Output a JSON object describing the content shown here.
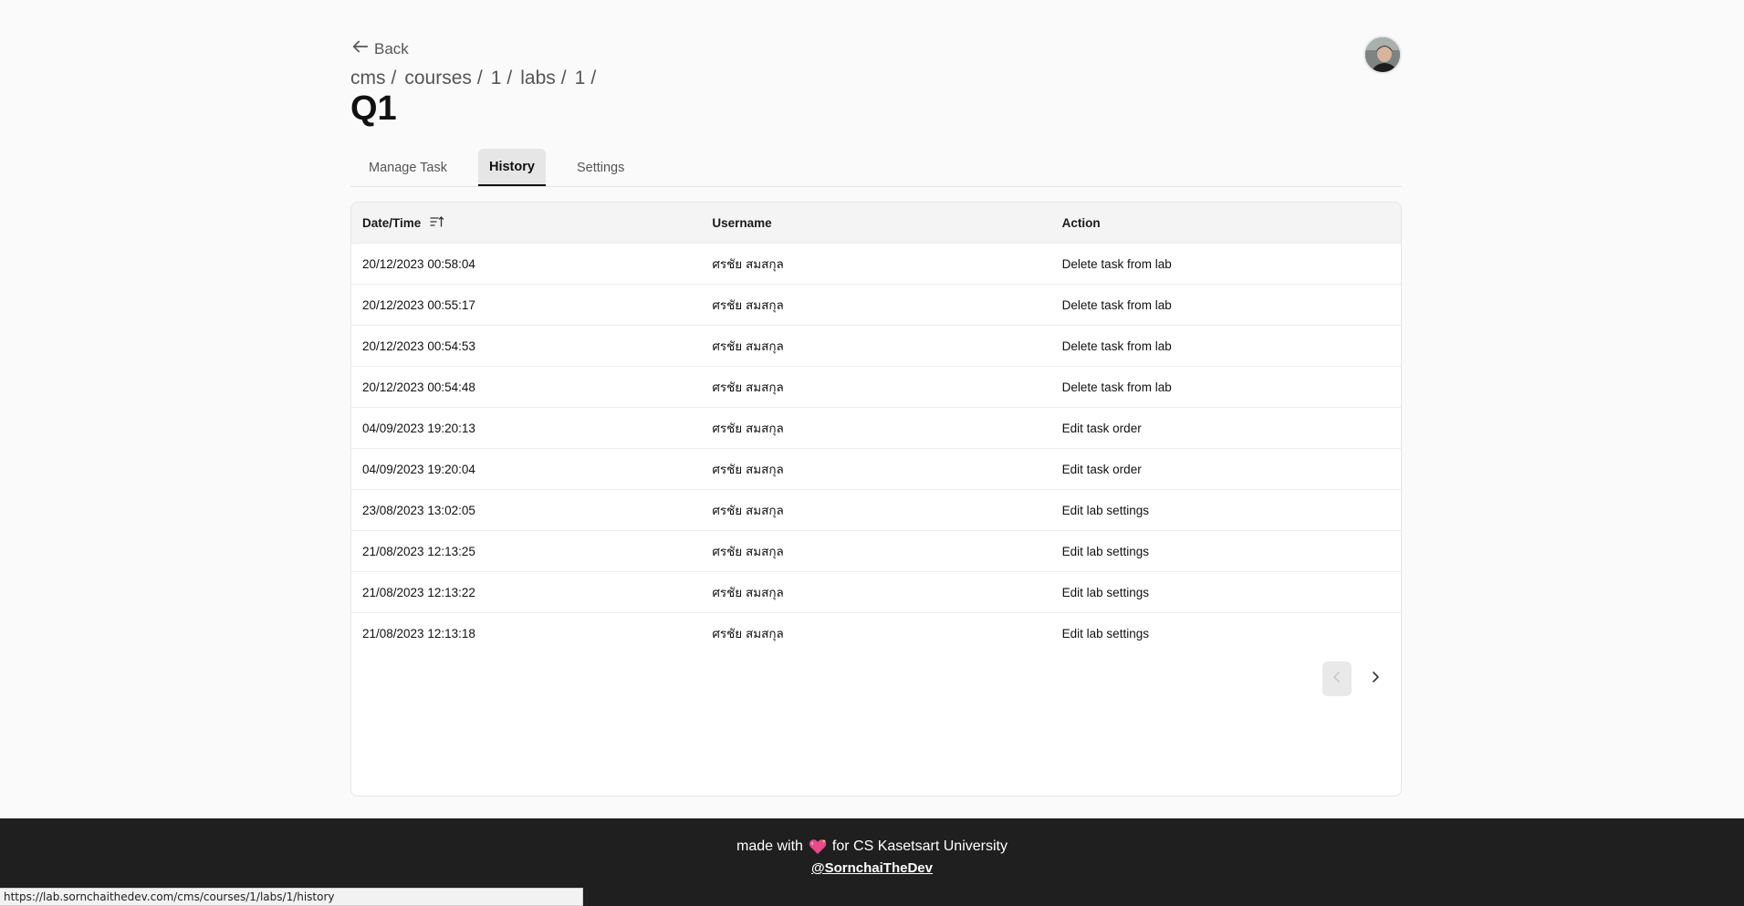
{
  "nav": {
    "back_label": "Back"
  },
  "breadcrumb": [
    {
      "label": "cms",
      "sep": "/"
    },
    {
      "label": "courses",
      "sep": "/"
    },
    {
      "label": "1",
      "sep": "/"
    },
    {
      "label": "labs",
      "sep": "/"
    },
    {
      "label": "1",
      "sep": "/"
    }
  ],
  "page": {
    "title": "Q1"
  },
  "tabs": [
    {
      "label": "Manage Task",
      "active": false
    },
    {
      "label": "History",
      "active": true
    },
    {
      "label": "Settings",
      "active": false
    }
  ],
  "table": {
    "headers": {
      "datetime": "Date/Time",
      "username": "Username",
      "action": "Action"
    },
    "rows": [
      {
        "datetime": "20/12/2023 00:58:04",
        "username": "ศรชัย สมสกุล",
        "action": "Delete task from lab"
      },
      {
        "datetime": "20/12/2023 00:55:17",
        "username": "ศรชัย สมสกุล",
        "action": "Delete task from lab"
      },
      {
        "datetime": "20/12/2023 00:54:53",
        "username": "ศรชัย สมสกุล",
        "action": "Delete task from lab"
      },
      {
        "datetime": "20/12/2023 00:54:48",
        "username": "ศรชัย สมสกุล",
        "action": "Delete task from lab"
      },
      {
        "datetime": "04/09/2023 19:20:13",
        "username": "ศรชัย สมสกุล",
        "action": "Edit task order"
      },
      {
        "datetime": "04/09/2023 19:20:04",
        "username": "ศรชัย สมสกุล",
        "action": "Edit task order"
      },
      {
        "datetime": "23/08/2023 13:02:05",
        "username": "ศรชัย สมสกุล",
        "action": "Edit lab settings"
      },
      {
        "datetime": "21/08/2023 12:13:25",
        "username": "ศรชัย สมสกุล",
        "action": "Edit lab settings"
      },
      {
        "datetime": "21/08/2023 12:13:22",
        "username": "ศรชัย สมสกุล",
        "action": "Edit lab settings"
      },
      {
        "datetime": "21/08/2023 12:13:18",
        "username": "ศรชัย สมสกุล",
        "action": "Edit lab settings"
      }
    ]
  },
  "pagination": {
    "prev_disabled": true
  },
  "footer": {
    "made_with": "made with",
    "for_text": "for CS Kasetsart University",
    "handle": "@SornchaiTheDev"
  },
  "status_bar": {
    "url": "https://lab.sornchaithedev.com/cms/courses/1/labs/1/history"
  },
  "icons": {
    "back": "arrow-left-icon",
    "sort": "sort-ascending-icon",
    "prev": "chevron-left-icon",
    "next": "chevron-right-icon",
    "heart": "sparkling-heart-icon"
  },
  "colors": {
    "footer_bg": "#1f1f1f",
    "heart": "#e84a8a"
  }
}
